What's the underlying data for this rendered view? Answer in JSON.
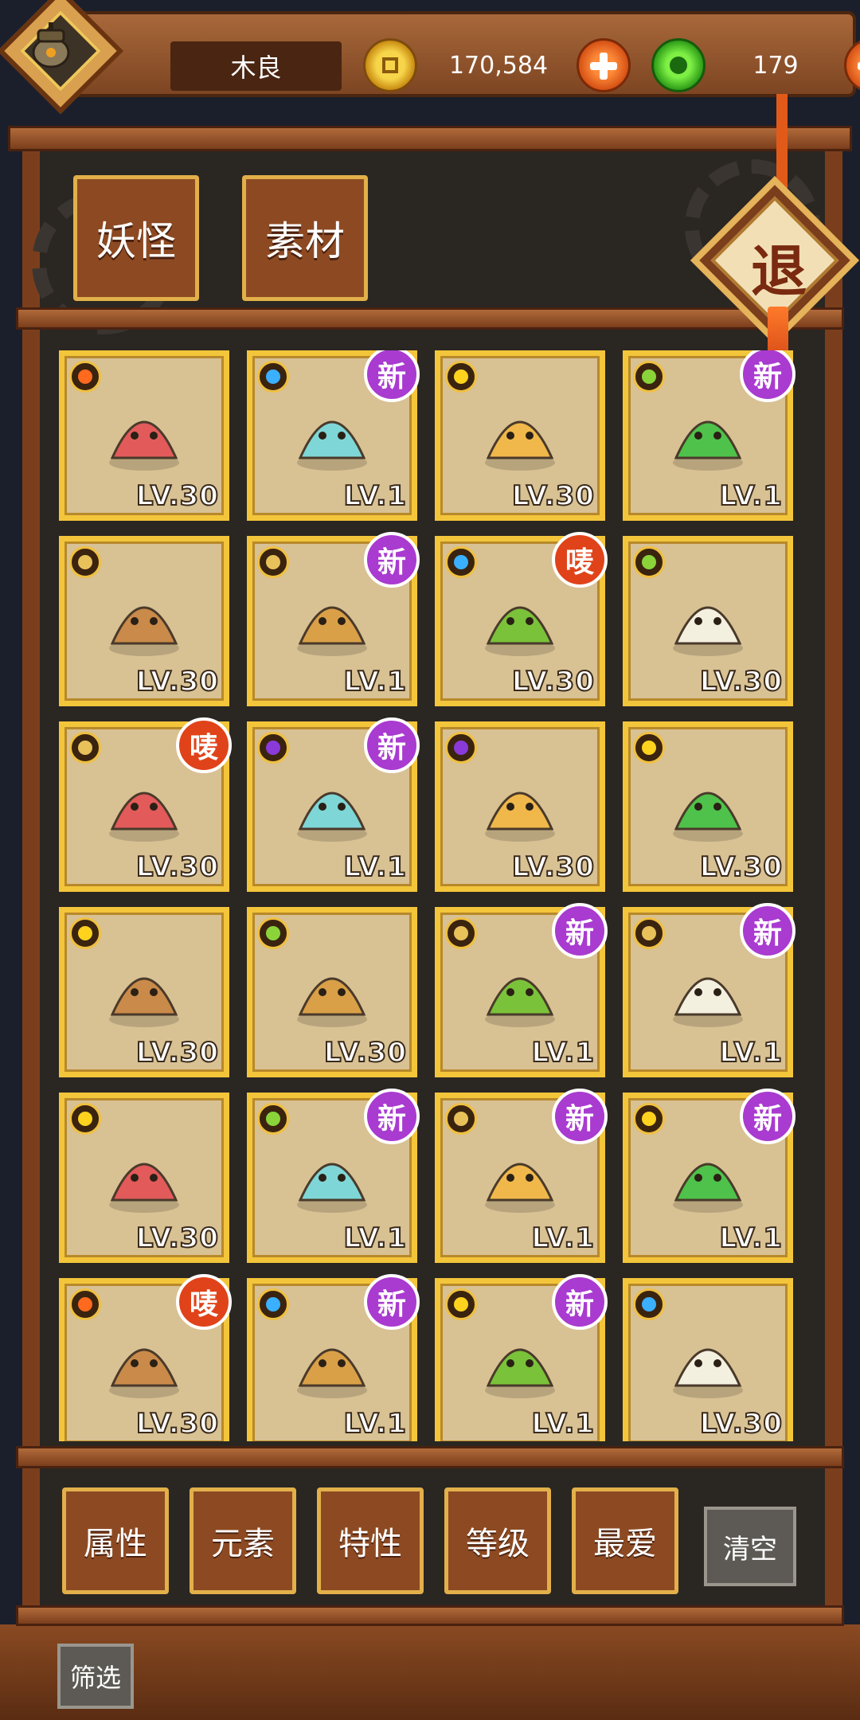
{
  "header": {
    "player_name": "木良",
    "coins": "170,584",
    "jade": "179"
  },
  "tabs": [
    {
      "label": "妖怪"
    },
    {
      "label": "素材"
    }
  ],
  "exit_label": "退",
  "badges": {
    "new": "新",
    "favorite": "唛"
  },
  "items": [
    {
      "element": "fire",
      "art": "heart-card-icon",
      "level": "LV.30",
      "badge": ""
    },
    {
      "element": "water",
      "art": "ghost-shell-icon",
      "level": "LV.1",
      "badge": "new"
    },
    {
      "element": "sun",
      "art": "roll-cake-icon",
      "level": "LV.30",
      "badge": ""
    },
    {
      "element": "wood",
      "art": "green-star-icon",
      "level": "LV.1",
      "badge": "new"
    },
    {
      "element": "earth",
      "art": "goddess-icon",
      "level": "LV.30",
      "badge": ""
    },
    {
      "element": "earth",
      "art": "leo-star-icon",
      "level": "LV.1",
      "badge": "new"
    },
    {
      "element": "water",
      "art": "green-ring-icon",
      "level": "LV.30",
      "badge": "favorite"
    },
    {
      "element": "wood",
      "art": "dumpling-box-icon",
      "level": "LV.30",
      "badge": ""
    },
    {
      "element": "earth",
      "art": "monkey-keychain-icon",
      "level": "LV.30",
      "badge": "favorite"
    },
    {
      "element": "moon",
      "art": "boy-hat-icon",
      "level": "LV.1",
      "badge": "new"
    },
    {
      "element": "moon",
      "art": "princess-cake-icon",
      "level": "LV.30",
      "badge": ""
    },
    {
      "element": "sun",
      "art": "drum-ghost-icon",
      "level": "LV.30",
      "badge": ""
    },
    {
      "element": "sun",
      "art": "snow-gift-icon",
      "level": "LV.30",
      "badge": ""
    },
    {
      "element": "wood",
      "art": "santa-hat-icon",
      "level": "LV.30",
      "badge": ""
    },
    {
      "element": "earth",
      "art": "green-rock-icon",
      "level": "LV.1",
      "badge": "new"
    },
    {
      "element": "earth",
      "art": "leaf-branch-icon",
      "level": "LV.1",
      "badge": "new"
    },
    {
      "element": "sun",
      "art": "mouse-box-icon",
      "level": "LV.30",
      "badge": ""
    },
    {
      "element": "wood",
      "art": "corn-icon",
      "level": "LV.1",
      "badge": "new"
    },
    {
      "element": "earth",
      "art": "watermelon-icon",
      "level": "LV.1",
      "badge": "new"
    },
    {
      "element": "sun",
      "art": "moon-cow-icon",
      "level": "LV.1",
      "badge": "new"
    },
    {
      "element": "fire",
      "art": "fox-icon",
      "level": "LV.30",
      "badge": "favorite"
    },
    {
      "element": "water",
      "art": "ice-block-icon",
      "level": "LV.1",
      "badge": "new"
    },
    {
      "element": "sun",
      "art": "bamboo-cage-icon",
      "level": "LV.1",
      "badge": "new"
    },
    {
      "element": "water",
      "art": "mahjong-north-icon",
      "level": "LV.30",
      "badge": ""
    }
  ],
  "filters": [
    {
      "label": "属性"
    },
    {
      "label": "元素"
    },
    {
      "label": "特性"
    },
    {
      "label": "等级"
    },
    {
      "label": "最爱"
    }
  ],
  "clear_label": "清空",
  "filter_label": "筛选",
  "colors": {
    "wood_dark": "#7b3e1c",
    "card_frame": "#f3c53a",
    "new_badge": "#a93bd0",
    "favorite_badge": "#e0431a"
  }
}
